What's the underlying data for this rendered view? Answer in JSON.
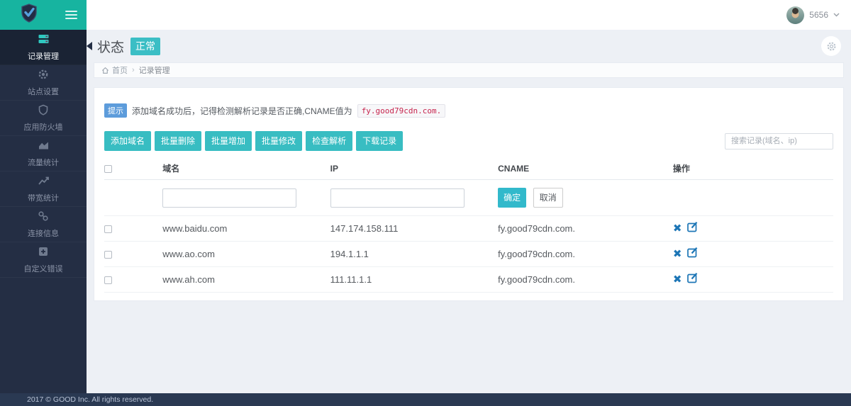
{
  "topbar": {
    "username": "5656"
  },
  "sidebar": {
    "items": [
      {
        "label": "记录管理",
        "icon": "server-icon",
        "active": true
      },
      {
        "label": "站点设置",
        "icon": "gear-icon",
        "active": false
      },
      {
        "label": "应用防火墙",
        "icon": "shield-icon",
        "active": false
      },
      {
        "label": "流量统计",
        "icon": "area-chart-icon",
        "active": false
      },
      {
        "label": "带宽统计",
        "icon": "line-chart-icon",
        "active": false
      },
      {
        "label": "连接信息",
        "icon": "link-icon",
        "active": false
      },
      {
        "label": "自定义错误",
        "icon": "plus-square-icon",
        "active": false
      }
    ]
  },
  "header": {
    "status_label": "状态",
    "status_value": "正常"
  },
  "breadcrumb": {
    "home": "首页",
    "separator": "›",
    "current": "记录管理"
  },
  "alert": {
    "badge": "提示",
    "text": "添加域名成功后，记得检测解析记录是否正确,CNAME值为",
    "code": "fy.good79cdn.com."
  },
  "toolbar": {
    "buttons": [
      "添加域名",
      "批量删除",
      "批量增加",
      "批量修改",
      "检查解析",
      "下载记录"
    ],
    "search_placeholder": "搜索记录(域名、ip)"
  },
  "table": {
    "headers": {
      "domain": "域名",
      "ip": "IP",
      "cname": "CNAME",
      "actions": "操作"
    },
    "edit_row": {
      "confirm_label": "确定",
      "cancel_label": "取消"
    },
    "rows": [
      {
        "domain": "www.baidu.com",
        "ip": "147.174.158.111",
        "cname": "fy.good79cdn.com."
      },
      {
        "domain": "www.ao.com",
        "ip": "194.1.1.1",
        "cname": "fy.good79cdn.com."
      },
      {
        "domain": "www.ah.com",
        "ip": "111.11.1.1",
        "cname": "fy.good79cdn.com."
      }
    ]
  },
  "footer": {
    "text": "2017 © GOOD Inc. All rights reserved."
  },
  "colors": {
    "topbar_teal": "#17b4a0",
    "button_teal": "#38bdc2",
    "confirm_teal": "#32b9cb",
    "sidebar_navy": "#242e44",
    "footer_navy": "#2a3952",
    "action_blue": "#1d76b6",
    "alert_badge_blue": "#5d9cdb",
    "code_red": "#c7254e"
  }
}
